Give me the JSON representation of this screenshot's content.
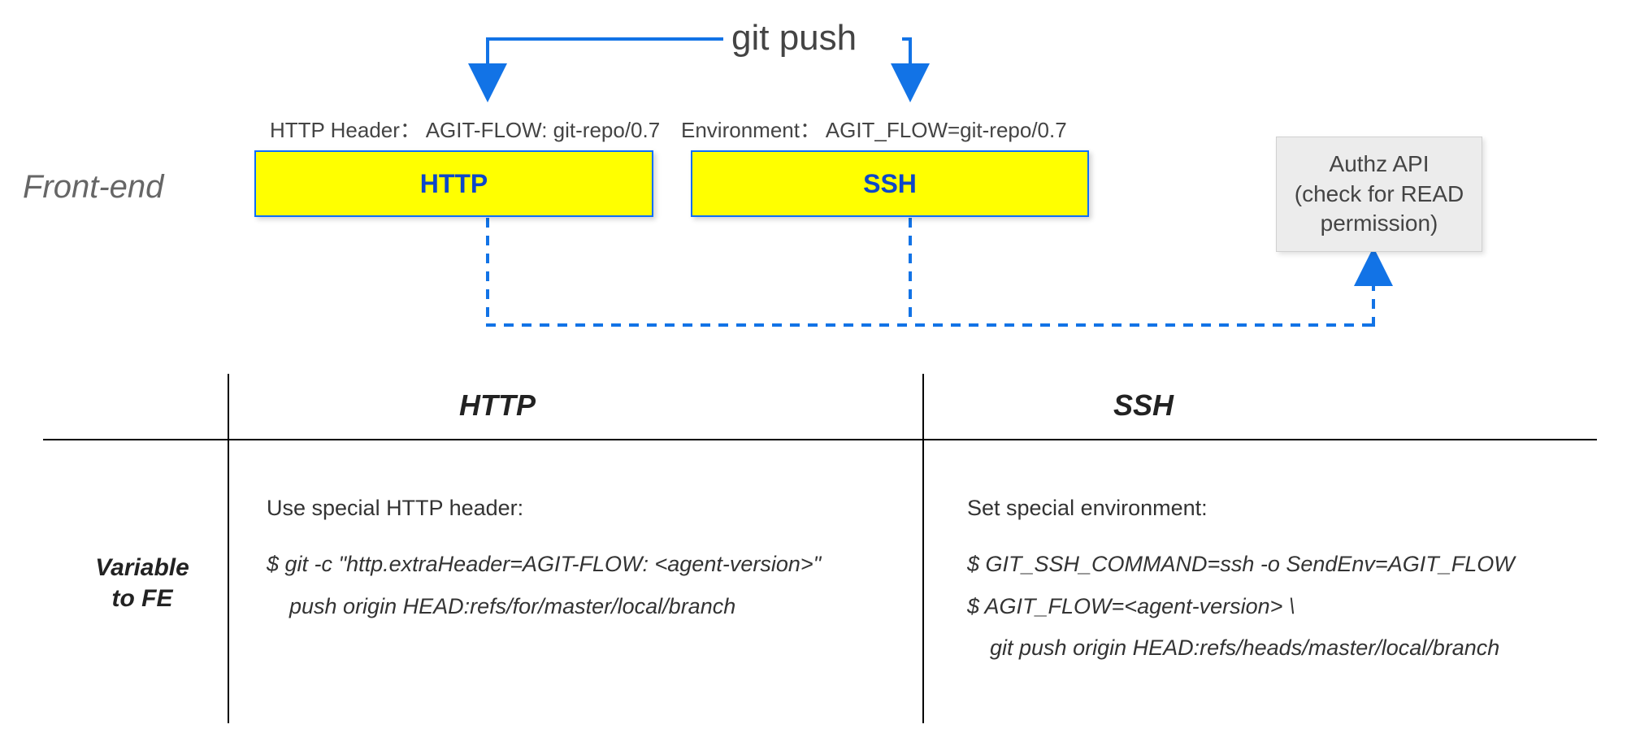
{
  "top": {
    "gitPush": "git push",
    "httpHeaderLabel": "HTTP Header： AGIT-FLOW: git-repo/0.7",
    "envLabel": "Environment： AGIT_FLOW=git-repo/0.7",
    "frontEnd": "Front-end",
    "httpBox": "HTTP",
    "sshBox": "SSH",
    "authzLine1": "Authz API",
    "authzLine2": "(check for READ",
    "authzLine3": "permission)"
  },
  "table": {
    "colHttp": "HTTP",
    "colSsh": "SSH",
    "rowLabel1": "Variable",
    "rowLabel2": "to FE",
    "httpCell": {
      "intro": "Use special HTTP header:",
      "line1": "$ git -c \"http.extraHeader=AGIT-FLOW: <agent-version>\"",
      "line2": "push origin HEAD:refs/for/master/local/branch"
    },
    "sshCell": {
      "intro": "Set special environment:",
      "line1": "$ GIT_SSH_COMMAND=ssh -o SendEnv=AGIT_FLOW",
      "line2": "$ AGIT_FLOW=<agent-version> \\",
      "line3": "git push origin HEAD:refs/heads/master/local/branch"
    }
  },
  "colors": {
    "arrowBlue": "#1273e6",
    "boxYellow": "#ffff00",
    "boxBorderBlue": "#0d6efd",
    "authzGray": "#ececec"
  }
}
